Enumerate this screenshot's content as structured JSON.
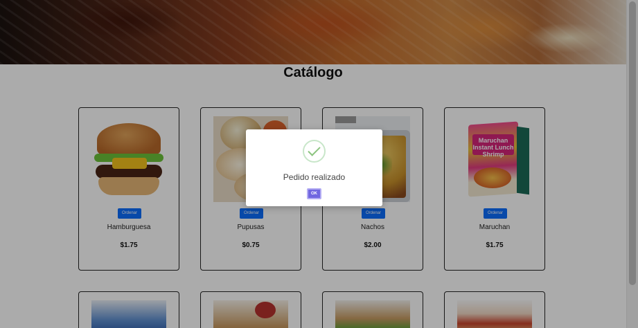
{
  "page": {
    "title": "Catálogo"
  },
  "products": [
    {
      "name": "Hamburguesa",
      "price": "$1.75",
      "button": "Ordenar",
      "image": "hamburger-image"
    },
    {
      "name": "Pupusas",
      "price": "$0.75",
      "button": "Ordenar",
      "image": "pupusas-image"
    },
    {
      "name": "Nachos",
      "price": "$2.00",
      "button": "Ordenar",
      "image": "nachos-image"
    },
    {
      "name": "Maruchan",
      "price": "$1.75",
      "button": "Ordenar",
      "image": "maruchan-image"
    }
  ],
  "maruchan_packaging_text": "Maruchan Instant Lunch Shrimp",
  "modal": {
    "icon": "success-check-icon",
    "title": "Pedido realizado",
    "ok_label": "OK",
    "colors": {
      "confirm": "#7066e0",
      "success": "#8cc47f"
    }
  },
  "colors": {
    "order_button": "#0d6efd"
  }
}
